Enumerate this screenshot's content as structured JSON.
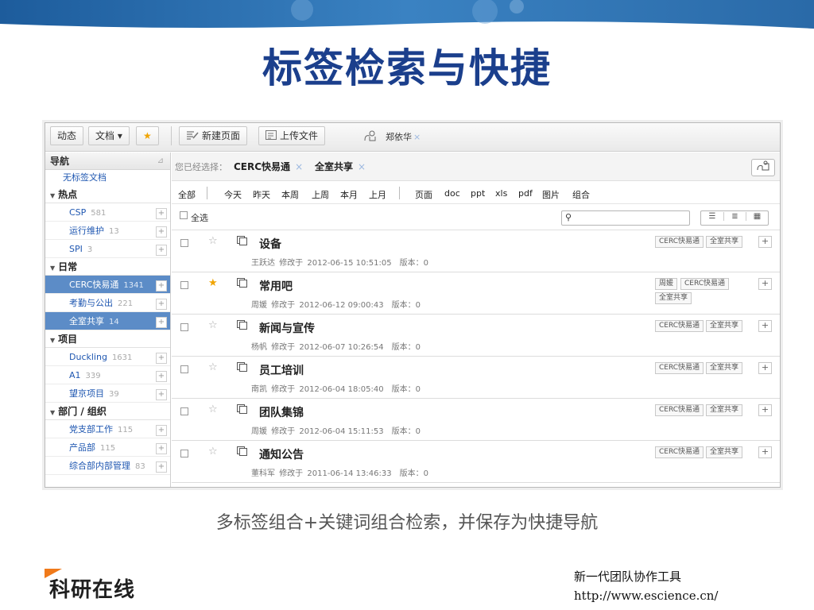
{
  "slide": {
    "title": "标签检索与快捷",
    "caption": "多标签组合+关键词组合检索，并保存为快捷导航",
    "logo_text": "科研在线",
    "footer_line1": "新一代团队协作工具",
    "footer_line2": "http://www.escience.cn/"
  },
  "toolbar": {
    "dynamic": "动态",
    "docs": "文档",
    "docs_caret": "▾",
    "favorite_icon": "★",
    "new_page": "新建页面",
    "upload": "上传文件",
    "user": "郑依华",
    "close": "×"
  },
  "sidebar": {
    "header": "导航",
    "pin": "⊿",
    "untagged": "无标签文档",
    "groups": [
      {
        "label": "热点",
        "items": [
          {
            "name": "CSP",
            "count": "581"
          },
          {
            "name": "运行维护",
            "count": "13"
          },
          {
            "name": "SPI",
            "count": "3"
          }
        ]
      },
      {
        "label": "日常",
        "items": [
          {
            "name": "CERC快易通",
            "count": "1341"
          },
          {
            "name": "考勤与公出",
            "count": "221"
          },
          {
            "name": "全室共享",
            "count": "14"
          }
        ]
      },
      {
        "label": "项目",
        "items": [
          {
            "name": "Duckling",
            "count": "1631"
          },
          {
            "name": "A1",
            "count": "339"
          },
          {
            "name": "望京项目",
            "count": "39"
          }
        ]
      },
      {
        "label": "部门 / 组织",
        "items": [
          {
            "name": "党支部工作",
            "count": "115"
          },
          {
            "name": "产品部",
            "count": "115"
          },
          {
            "name": "综合部内部管理",
            "count": "83"
          }
        ]
      }
    ],
    "plus": "+"
  },
  "crumb": {
    "label": "您已经选择：",
    "tag1": "CERC快易通",
    "tag2": "全室共享",
    "x": "×"
  },
  "filters": {
    "all": "全部",
    "time": [
      "今天",
      "昨天",
      "本周",
      "上周",
      "本月",
      "上月"
    ],
    "types": [
      "页面",
      "doc",
      "ppt",
      "xls",
      "pdf",
      "图片",
      "组合"
    ]
  },
  "list": {
    "select_all": "全选",
    "search_placeholder": "",
    "search_icon": "⚲",
    "view_icons": [
      "☰",
      "≣",
      "▦"
    ],
    "version_label": "版本：",
    "modified_label": "修改于",
    "star_off": "☆",
    "star_on": "★",
    "add": "+",
    "rows": [
      {
        "title": "设备",
        "author": "王跃达",
        "date": "2012-06-15 10:51:05",
        "version": "0",
        "starred": false,
        "tags": [
          "CERC快易通",
          "全室共享"
        ]
      },
      {
        "title": "常用吧",
        "author": "周媛",
        "date": "2012-06-12 09:00:43",
        "version": "0",
        "starred": true,
        "tags": [
          "周媛",
          "CERC快易通",
          "全室共享"
        ]
      },
      {
        "title": "新闻与宣传",
        "author": "杨帆",
        "date": "2012-06-07 10:26:54",
        "version": "0",
        "starred": false,
        "tags": [
          "CERC快易通",
          "全室共享"
        ]
      },
      {
        "title": "员工培训",
        "author": "南凯",
        "date": "2012-06-04 18:05:40",
        "version": "0",
        "starred": false,
        "tags": [
          "CERC快易通",
          "全室共享"
        ]
      },
      {
        "title": "团队集锦",
        "author": "周媛",
        "date": "2012-06-04 15:11:53",
        "version": "0",
        "starred": false,
        "tags": [
          "CERC快易通",
          "全室共享"
        ]
      },
      {
        "title": "通知公告",
        "author": "董科军",
        "date": "2011-06-14 13:46:33",
        "version": "0",
        "starred": false,
        "tags": [
          "CERC快易通",
          "全室共享"
        ]
      }
    ]
  },
  "colors": {
    "title_blue": "#1b3f8c",
    "banner_blue": "#2a6aa8",
    "active_nav": "#5c8cc7",
    "star_on": "#f0a400",
    "logo_orange": "#f07a1a"
  }
}
